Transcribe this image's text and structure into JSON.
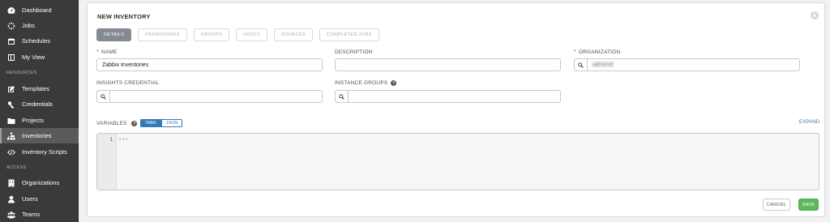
{
  "sidebar": {
    "items": [
      {
        "label": "Dashboard",
        "icon": "dashboard-icon"
      },
      {
        "label": "Jobs",
        "icon": "jobs-icon"
      },
      {
        "label": "Schedules",
        "icon": "calendar-icon"
      },
      {
        "label": "My View",
        "icon": "view-icon"
      }
    ],
    "resources_heading": "RESOURCES",
    "resources": [
      {
        "label": "Templates",
        "icon": "pencil-icon"
      },
      {
        "label": "Credentials",
        "icon": "key-icon"
      },
      {
        "label": "Projects",
        "icon": "folder-icon"
      },
      {
        "label": "Inventories",
        "icon": "sitemap-icon",
        "active": true
      },
      {
        "label": "Inventory Scripts",
        "icon": "code-icon"
      }
    ],
    "access_heading": "ACCESS",
    "access": [
      {
        "label": "Organizations",
        "icon": "building-icon"
      },
      {
        "label": "Users",
        "icon": "user-icon"
      },
      {
        "label": "Teams",
        "icon": "users-icon"
      }
    ]
  },
  "form": {
    "title": "NEW INVENTORY",
    "tabs": [
      "DETAILS",
      "PERMISSIONS",
      "GROUPS",
      "HOSTS",
      "SOURCES",
      "COMPLETED JOBS"
    ],
    "name_label": "NAME",
    "name_value": "Zabbix Inventories",
    "description_label": "DESCRIPTION",
    "description_value": "",
    "organization_label": "ORGANIZATION",
    "organization_value": "MEWVE",
    "insights_label": "INSIGHTS CREDENTIAL",
    "insights_value": "",
    "instance_groups_label": "INSTANCE GROUPS",
    "instance_groups_value": "",
    "variables_label": "VARIABLES",
    "yaml_label": "YAML",
    "json_label": "JSON",
    "expand_label": "EXPAND",
    "editor_line_number": "1",
    "editor_content": "---",
    "cancel_label": "CANCEL",
    "save_label": "SAVE"
  },
  "colors": {
    "sidebar_bg": "#3a3a3a",
    "accent_blue": "#337ab7",
    "save_green": "#5cb85c",
    "required_red": "#d9534f"
  }
}
